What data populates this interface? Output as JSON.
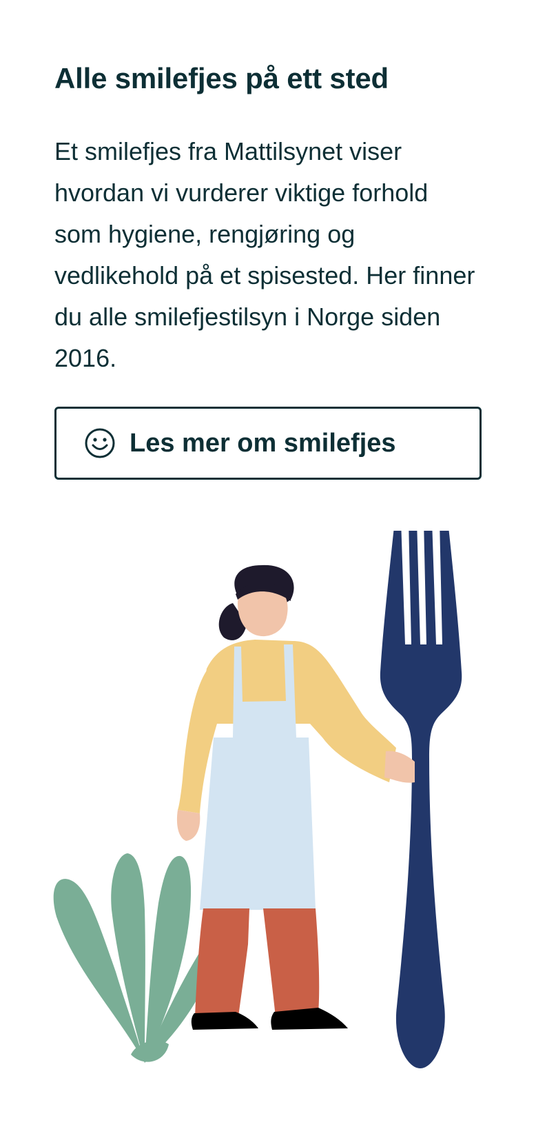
{
  "section": {
    "title": "Alle smilefjes på ett sted",
    "intro": "Et smilefjes fra Mattilsynet viser hvordan vi vurderer viktige forhold som hygiene, rengjøring og vedlikehold på et spisested. Her finner du alle smilefjestilsyn i Norge siden 2016."
  },
  "read_more_button": {
    "label": "Les mer om smilefjes",
    "icon": "smiley-icon"
  },
  "illustration": {
    "subject": "chef-with-fork-and-plant",
    "colors": {
      "fork": "#22376a",
      "apron": "#d3e4f2",
      "shirt": "#f2ce82",
      "pants": "#c96047",
      "skin": "#f1c4aa",
      "hair": "#1e1a2c",
      "plant": "#7aae96",
      "shoes": "#000000",
      "text": "#0d2f35"
    }
  }
}
